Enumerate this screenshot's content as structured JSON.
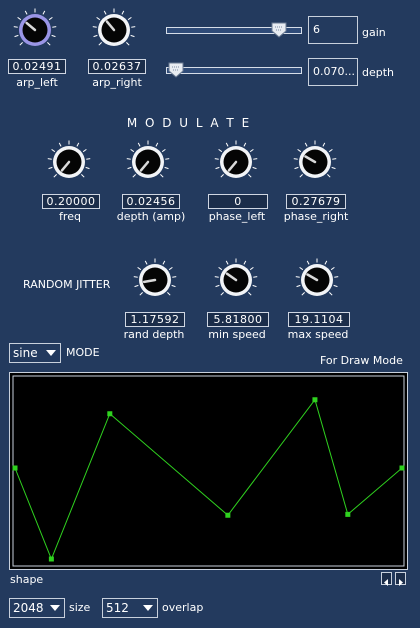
{
  "top": {
    "knobs": [
      {
        "value": "0.02491",
        "label": "arp_left",
        "angle": -50,
        "focused": true
      },
      {
        "value": "0.02637",
        "label": "arp_right",
        "angle": -40,
        "focused": false
      }
    ],
    "sliders": [
      {
        "value": "6",
        "label": "gain",
        "position": 0.89
      },
      {
        "value": "0.070...",
        "label": "depth",
        "position": 0.02
      }
    ]
  },
  "modulate": {
    "title": "M O D U L A T E",
    "knobs": [
      {
        "value": "0.20000",
        "label": "freq",
        "angle": -140
      },
      {
        "value": "0.02456",
        "label": "depth (amp)",
        "angle": -140
      },
      {
        "value": "0",
        "label": "phase_left",
        "angle": -140
      },
      {
        "value": "0.27679",
        "label": "phase_right",
        "angle": -60
      }
    ]
  },
  "jitter": {
    "title": "RANDOM JITTER",
    "knobs": [
      {
        "value": "1.17592",
        "label": "rand depth",
        "angle": -100
      },
      {
        "value": "5.81800",
        "label": "min speed",
        "angle": -55
      },
      {
        "value": "19.1104",
        "label": "max speed",
        "angle": -60
      }
    ]
  },
  "mode": {
    "selected": "sine",
    "label": "MODE",
    "draw_mode_label": "For Draw Mode"
  },
  "shape": {
    "label": "shape",
    "points": [
      {
        "x": 0.0,
        "y": 0.48
      },
      {
        "x": 0.094,
        "y": 1.0
      },
      {
        "x": 0.245,
        "y": 0.17
      },
      {
        "x": 0.55,
        "y": 0.75
      },
      {
        "x": 0.775,
        "y": 0.09
      },
      {
        "x": 0.86,
        "y": 0.745
      },
      {
        "x": 1.0,
        "y": 0.48
      }
    ]
  },
  "bottom": {
    "size": {
      "selected": "2048",
      "label": "size"
    },
    "overlap": {
      "selected": "512",
      "label": "overlap"
    }
  }
}
